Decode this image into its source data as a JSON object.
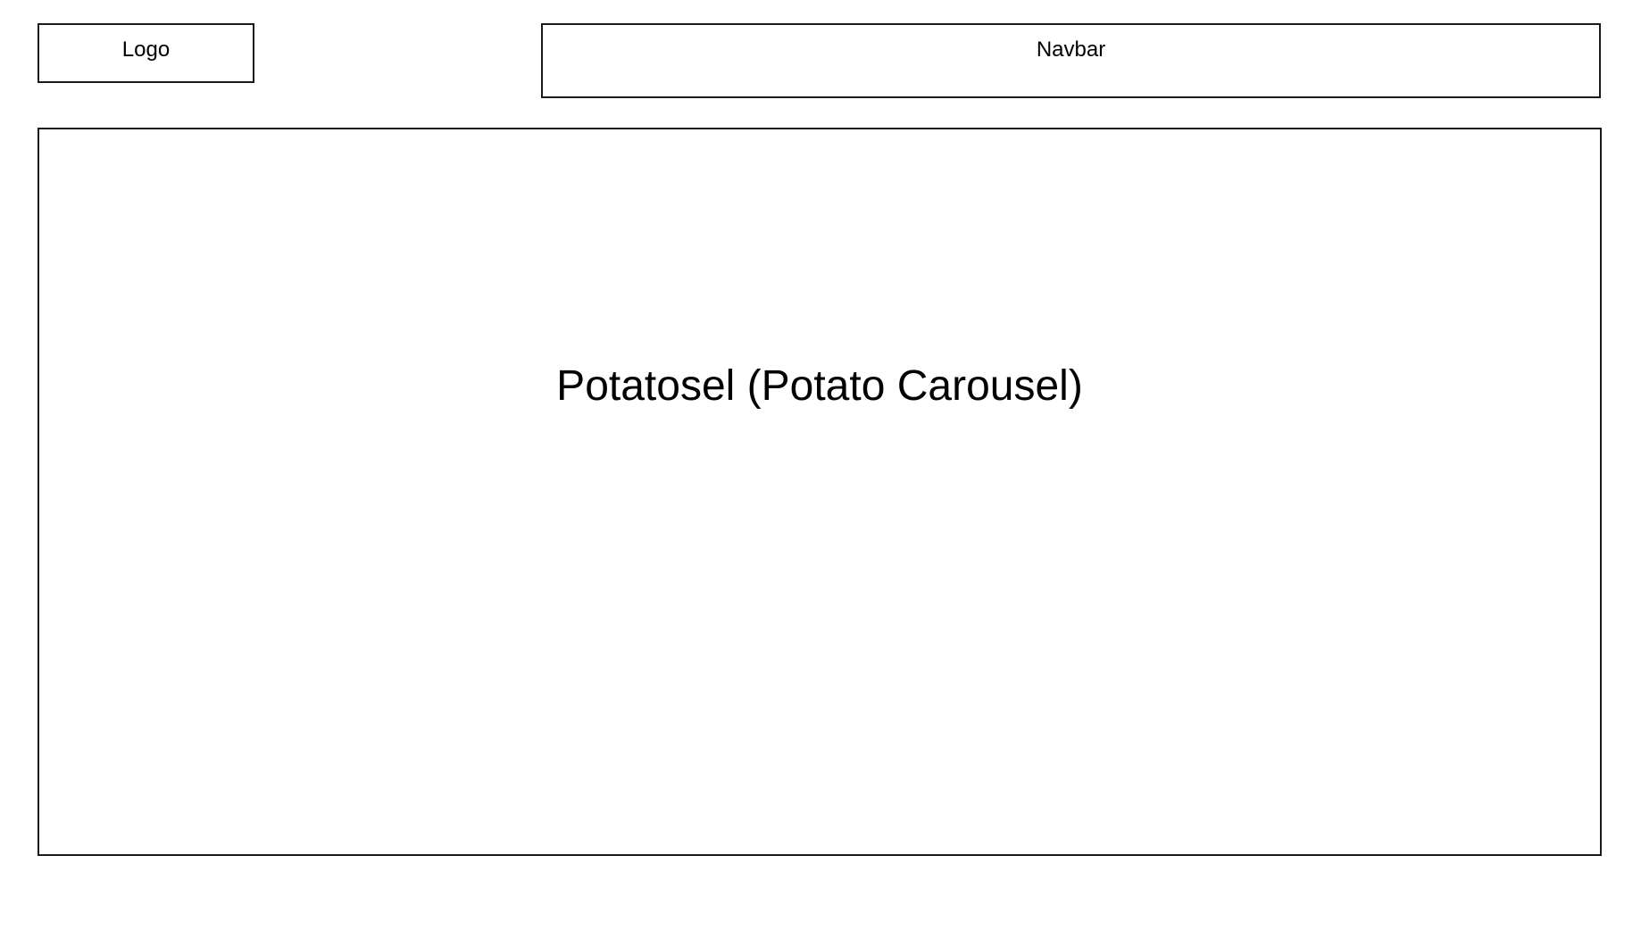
{
  "header": {
    "logo_label": "Logo",
    "navbar_label": "Navbar"
  },
  "main": {
    "carousel_label": "Potatosel (Potato Carousel)"
  },
  "colors": {
    "border": "#1a1a1a",
    "background": "#ffffff",
    "text": "#000000"
  }
}
